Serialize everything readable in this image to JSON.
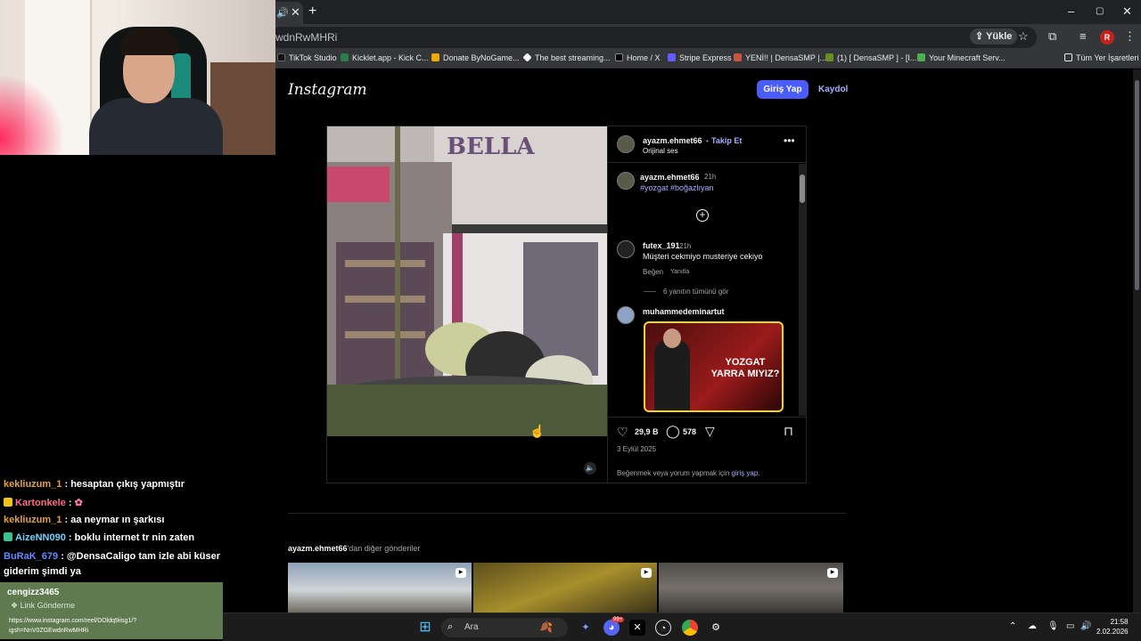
{
  "browser": {
    "url": "wdnRwMHRi",
    "new_tab": "+",
    "close_tab": "✕",
    "upload_label": "Yükle",
    "bookmarks": [
      {
        "label": "TikTok Studio",
        "color": "#111111"
      },
      {
        "label": "Kicklet.app - Kick C...",
        "color": "#2d7d46"
      },
      {
        "label": "Donate ByNoGame...",
        "color": "#f2a900"
      },
      {
        "label": "The best streaming...",
        "color": "#f5f5f5"
      },
      {
        "label": "Home / X",
        "color": "#000000"
      },
      {
        "label": "Stripe Express",
        "color": "#635bff"
      },
      {
        "label": "YENİ!! | DensaSMP |...",
        "color": "#c8553d"
      },
      {
        "label": "(1) [ DensaSMP ] - [I...",
        "color": "#6b8e23"
      },
      {
        "label": "Your Minecraft Serv...",
        "color": "#4caf50"
      }
    ],
    "all_bookmarks": "Tüm Yer İşaretleri",
    "window": {
      "minimize": "–",
      "maximize": "▢",
      "close": "✕"
    }
  },
  "instagram": {
    "logo": "Instagram",
    "login_button": "Giriş Yap",
    "signup_link": "Kaydol",
    "post": {
      "author": "ayazm.ehmet66",
      "separator": "•",
      "follow": "Takip Et",
      "audio": "Orijinal ses",
      "more": "•••",
      "caption_author": "ayazm.ehmet66",
      "caption_time": "21h",
      "caption_tags": "#yozgat #boğazlıyan",
      "comments": [
        {
          "user": "futex_191",
          "time": "21h",
          "text": "Müşteri cekmiyo musteriye cekiyo",
          "like": "Beğen",
          "reply": "Yanıtla",
          "view_replies": "6 yanıtın tümünü gör"
        },
        {
          "user": "muhammedeminartut",
          "image_caption": "YOZGAT YARRA MIYIZ?"
        }
      ],
      "likes": "29,9 B",
      "comment_count": "578",
      "date": "3 Eylül 2025",
      "login_prompt": "Beğenmek veya yorum yapmak için",
      "login_prompt_link": "giriş yap",
      "login_prompt_end": ".",
      "video_sign": "BELLA"
    },
    "more_posts_user": "ayazm.ehmet66",
    "more_posts_text": "'dan diğer gönderiler"
  },
  "stream_overlay": {
    "chat": [
      {
        "user": "kekliuzum_1",
        "color": "#e6a23c",
        "message": ": hesaptan çıkış yapmıştır",
        "badge": ""
      },
      {
        "user": "Kartonkele",
        "color": "#ff6b81",
        "message": ":",
        "badge": "#f0c419"
      },
      {
        "user": "kekliuzum_1",
        "color": "#e6a23c",
        "message": ": aa neymar ın şarkısı",
        "badge": ""
      },
      {
        "user": "AizeNN090",
        "color": "#6fd3ff",
        "message": ": boklu internet tr nin zaten",
        "badge": "#3fbf8f"
      },
      {
        "user": "BuRaK_679",
        "color": "#5b8cff",
        "message": ": @DensaCaligo tam izle abi küser",
        "badge": ""
      }
    ],
    "chat_continuation": "giderim şimdi ya",
    "link_card": {
      "user": "cengizz3465",
      "tag": "Link Gönderme",
      "link": "https://www.instagram.com/reel/DOldq9iisg1/?igsh=NnV0ZGEwdnRwMHRi"
    }
  },
  "taskbar": {
    "search_placeholder": "Ara",
    "time": "21:58",
    "date": "2.02.2026",
    "notification_count": "99+"
  }
}
